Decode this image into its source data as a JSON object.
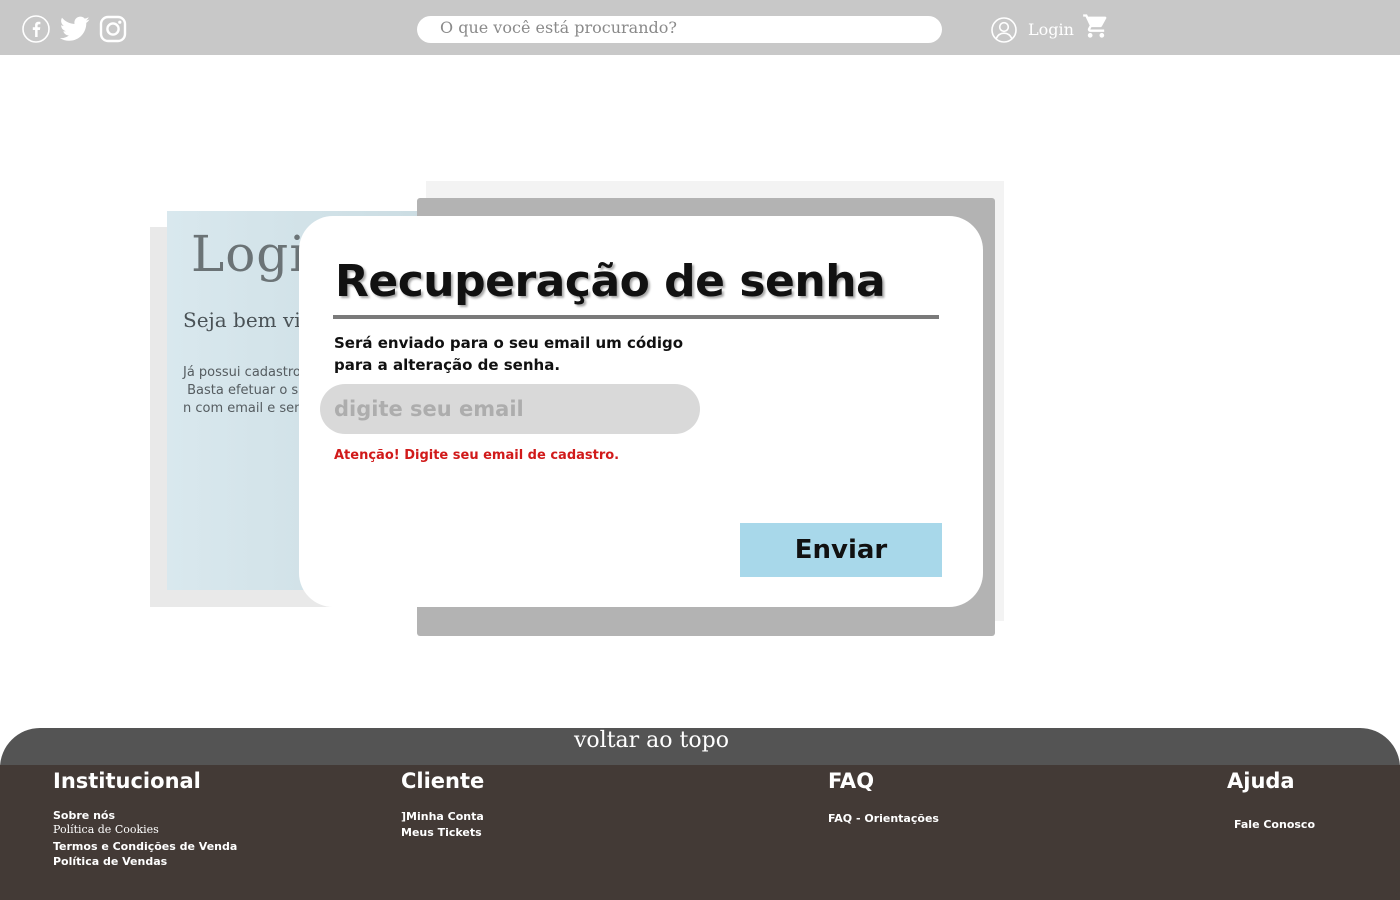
{
  "header": {
    "search_placeholder": "O que você está procurando?",
    "login_label": "Login",
    "social_icons": [
      "facebook-icon",
      "twitter-icon",
      "instagram-icon"
    ]
  },
  "background_login": {
    "title": "Logi",
    "subtitle": "Seja bem vi",
    "paragraph": "Já possui cadastro e\n Basta efetuar o seu\nn com email e senh"
  },
  "modal": {
    "title": "Recuperação de senha",
    "description_line1": "Será enviado para o seu email um código",
    "description_line2": "para a alteração de senha.",
    "email_placeholder": "digite seu email",
    "warning": "Atenção! Digite seu email de cadastro.",
    "send_label": "Enviar"
  },
  "footer": {
    "back_to_top": "voltar ao topo",
    "columns": [
      {
        "heading": "Institucional",
        "links": [
          "Sobre nós",
          "Política de Cookies",
          "Termos e Condições de Venda",
          "Política de Vendas"
        ]
      },
      {
        "heading": "Cliente",
        "links": [
          "]Minha Conta",
          "Meus Tickets"
        ]
      },
      {
        "heading": "FAQ",
        "links": [
          "FAQ - Orientações"
        ]
      },
      {
        "heading": "Ajuda",
        "links": [
          "Fale Conosco"
        ]
      }
    ]
  },
  "colors": {
    "topbar": "#c8c8c8",
    "accent_button": "#a8d8ea",
    "warning": "#d11a1a",
    "footer": "#433a36",
    "footer_tab": "#545454"
  }
}
